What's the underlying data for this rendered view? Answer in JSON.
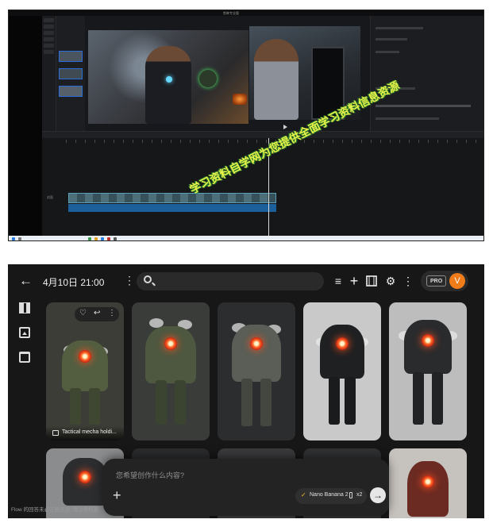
{
  "editor": {
    "window_title": "剪映专业版",
    "track_labels": [
      "封面"
    ],
    "watermark": "学习资料自学网为您提供全面学习资料信息资源"
  },
  "flow": {
    "header": {
      "title": "4月10日 21:00",
      "search_placeholder": "",
      "tools": [
        "filter-icon",
        "add-icon",
        "film-icon",
        "settings-icon",
        "more-icon"
      ],
      "plan_badge": "PRO",
      "avatar_initial": "V"
    },
    "rail": [
      "grid-view-icon",
      "image-icon",
      "add-folder-icon"
    ],
    "cards": [
      {
        "caption": "Tactical mecha holdi...",
        "bg": "#3b3d36",
        "body": "#535e41"
      },
      {
        "caption": "",
        "bg": "#3a3c3a",
        "body": "#4e5840"
      },
      {
        "caption": "",
        "bg": "#2c2d2f",
        "body": "#5a5e56"
      },
      {
        "caption": "",
        "bg": "#c9c9c9",
        "body": "#1f2022"
      },
      {
        "caption": "",
        "bg": "#bdbdbd",
        "body": "#2a2b2d"
      }
    ],
    "prompt": {
      "placeholder": "您希望创作什么内容?",
      "model": "Nano Banana 2",
      "count": "x2"
    },
    "footnote": "Flow 的回答未必正确无误, 请注意核查"
  },
  "colors": {
    "accent": "#f07c1a",
    "card_core": "#ff5020"
  }
}
